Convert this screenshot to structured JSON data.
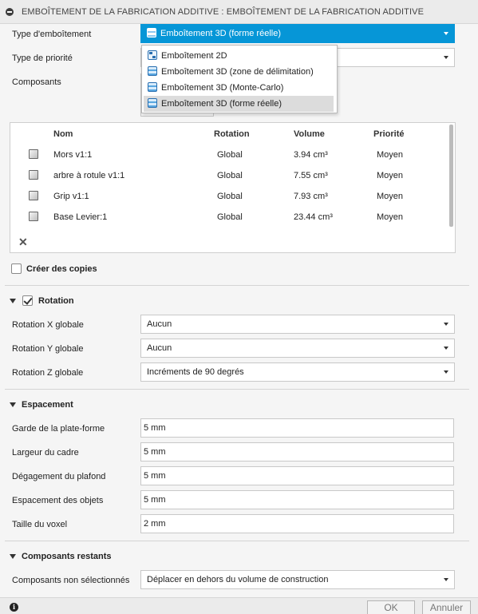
{
  "title": "EMBOÎTEMENT DE LA FABRICATION ADDITIVE : EMBOÎTEMENT DE LA FABRICATION ADDITIVE",
  "fields": {
    "nesting_type_label": "Type d'emboîtement",
    "nesting_type_value": "Emboîtement 3D (forme réelle)",
    "priority_type_label": "Type de priorité",
    "components_label": "Composants"
  },
  "dropdown": {
    "options": [
      "Emboîtement 2D",
      "Emboîtement 3D (zone de délimitation)",
      "Emboîtement 3D (Monte-Carlo)",
      "Emboîtement 3D (forme réelle)"
    ],
    "selected_index": 3
  },
  "table": {
    "headers": {
      "name": "Nom",
      "rotation": "Rotation",
      "volume": "Volume",
      "priority": "Priorité"
    },
    "rows": [
      {
        "name": "Mors v1:1",
        "rotation": "Global",
        "volume": "3.94 cm³",
        "priority": "Moyen"
      },
      {
        "name": "arbre à rotule v1:1",
        "rotation": "Global",
        "volume": "7.55 cm³",
        "priority": "Moyen"
      },
      {
        "name": "Grip v1:1",
        "rotation": "Global",
        "volume": "7.93 cm³",
        "priority": "Moyen"
      },
      {
        "name": "Base Levier:1",
        "rotation": "Global",
        "volume": "23.44 cm³",
        "priority": "Moyen"
      }
    ],
    "remove_symbol": "✕"
  },
  "create_copies": {
    "label": "Créer des copies",
    "checked": false
  },
  "rotation": {
    "header": "Rotation",
    "checked": true,
    "x_label": "Rotation X globale",
    "x_value": "Aucun",
    "y_label": "Rotation Y globale",
    "y_value": "Aucun",
    "z_label": "Rotation Z globale",
    "z_value": "Incréments de 90 degrés"
  },
  "spacing": {
    "header": "Espacement",
    "platform_label": "Garde de la plate-forme",
    "platform_value": "5 mm",
    "frame_label": "Largeur du cadre",
    "frame_value": "5 mm",
    "ceiling_label": "Dégagement du plafond",
    "ceiling_value": "5 mm",
    "objects_label": "Espacement des objets",
    "objects_value": "5 mm",
    "voxel_label": "Taille du voxel",
    "voxel_value": "2 mm"
  },
  "remaining": {
    "header": "Composants restants",
    "unselected_label": "Composants non sélectionnés",
    "unselected_value": "Déplacer en dehors du volume de construction"
  },
  "footer": {
    "info_glyph": "i",
    "ok_label": "OK",
    "cancel_label": "Annuler"
  },
  "colors": {
    "accent": "#0696d7",
    "selected_item": "#dcdcdc"
  }
}
